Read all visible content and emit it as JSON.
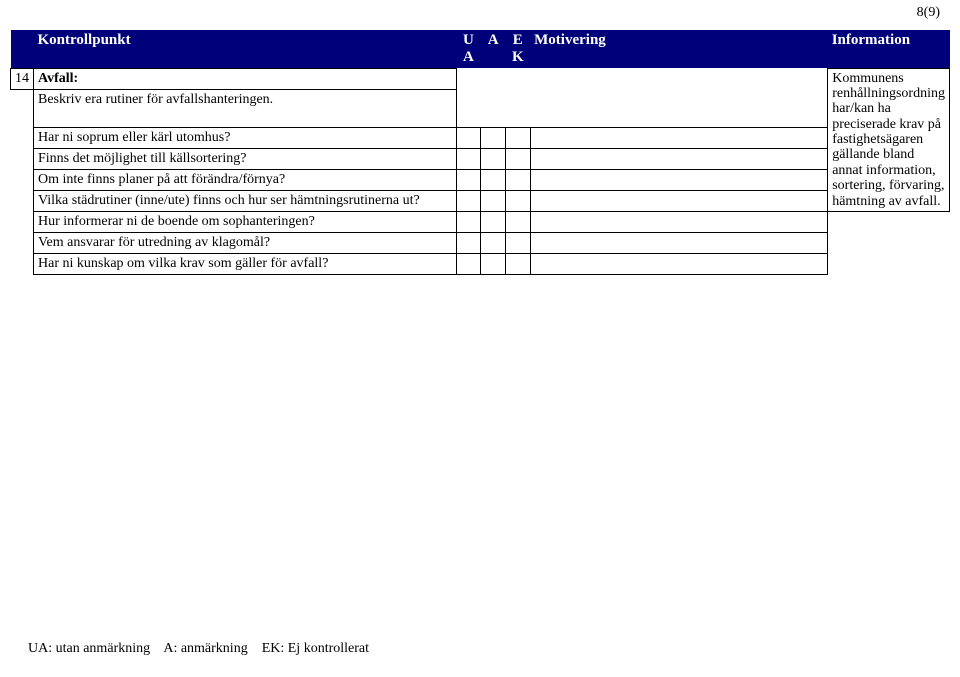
{
  "page_num": "8(9)",
  "header": {
    "kontrollpunkt": "Kontrollpunkt",
    "ua_top": "U",
    "ua_sub": "A",
    "a_top": "A",
    "ek_top": "E",
    "ek_sub": "K",
    "motivering": "Motivering",
    "information": "Information"
  },
  "section": {
    "num": "14",
    "title": "Avfall:"
  },
  "rows": [
    "Beskriv era rutiner för avfallshanteringen.",
    "Har ni soprum eller kärl utomhus?",
    "Finns det möjlighet till källsortering?",
    "Om inte finns planer på att förändra/förnya?",
    "Vilka städrutiner (inne/ute) finns och hur ser hämtningsrutinerna ut?",
    "Hur informerar ni de boende om sophanteringen?",
    "Vem ansvarar för utredning av klagomål?",
    "Har ni kunskap om vilka krav som gäller för avfall?"
  ],
  "info_text": "Kommunens renhållningsordning har/kan ha preciserade krav på fastighetsägaren gällande bland annat information, sortering, förvaring, hämtning av avfall.",
  "footer": {
    "ua": "UA: utan anmärkning",
    "a": "A: anmärkning",
    "ek": "EK: Ej kontrollerat"
  }
}
